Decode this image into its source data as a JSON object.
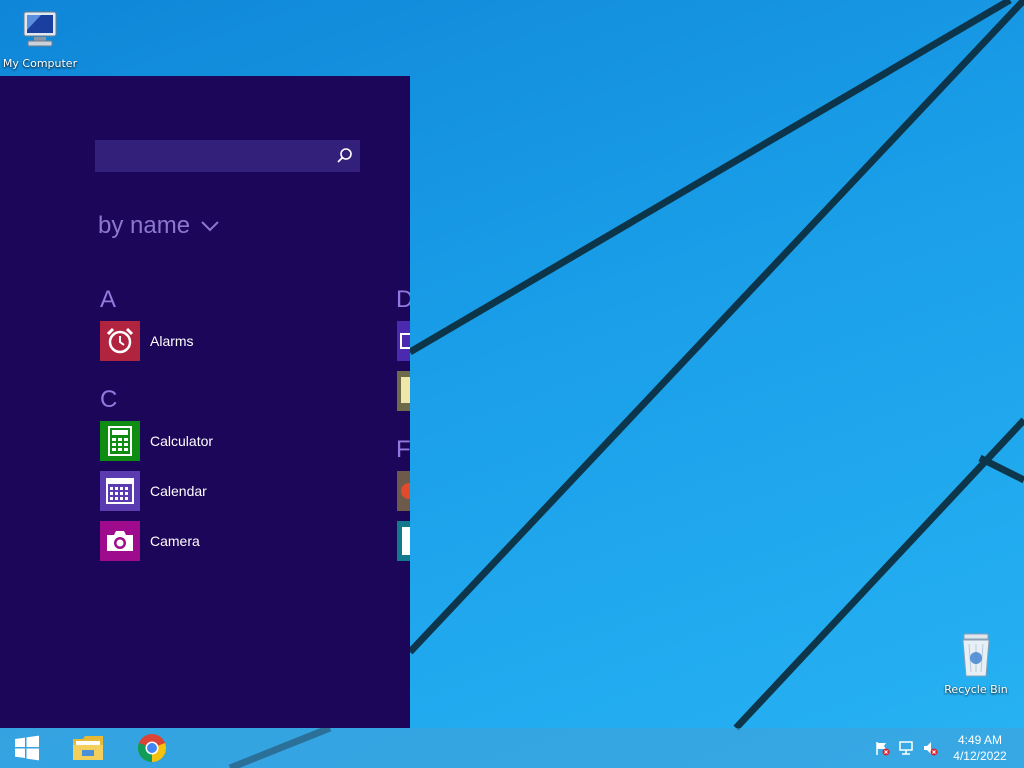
{
  "desktop": {
    "icons": [
      {
        "label": "My Computer",
        "icon": "computer-icon"
      },
      {
        "label": "Recycle Bin",
        "icon": "recycle-bin-icon"
      }
    ]
  },
  "start_apps": {
    "search": {
      "value": "",
      "placeholder": ""
    },
    "sort_label": "by name",
    "groups": [
      {
        "letter": "A",
        "apps": [
          {
            "label": "Alarms",
            "icon": "alarm-clock-icon",
            "color": "#b1243f"
          }
        ]
      },
      {
        "letter": "C",
        "apps": [
          {
            "label": "Calculator",
            "icon": "calculator-icon",
            "color": "#0f8c12"
          },
          {
            "label": "Calendar",
            "icon": "calendar-icon",
            "color": "#5a3bb1"
          },
          {
            "label": "Camera",
            "icon": "camera-icon",
            "color": "#9e0b8d"
          }
        ]
      },
      {
        "letter": "D",
        "apps": [
          {
            "icon": "app-icon",
            "color": "#4b2ab0"
          },
          {
            "icon": "app-icon",
            "color": "#6c6c4a"
          }
        ]
      },
      {
        "letter": "F",
        "apps": [
          {
            "icon": "app-icon",
            "color": "#6e5a4a"
          },
          {
            "icon": "app-icon",
            "color": "#127a8c"
          }
        ]
      }
    ]
  },
  "taskbar": {
    "pinned": [
      {
        "name": "File Explorer",
        "icon": "folder-icon"
      },
      {
        "name": "Google Chrome",
        "icon": "chrome-icon"
      }
    ],
    "tray": [
      "action-center-flag-icon",
      "network-icon",
      "volume-muted-icon"
    ],
    "clock": {
      "time": "4:49 AM",
      "date": "4/12/2022"
    }
  },
  "colors": {
    "start_bg": "#1c0659",
    "accent_text": "#8f7bdf",
    "wallpaper": "#1a9ee8"
  }
}
